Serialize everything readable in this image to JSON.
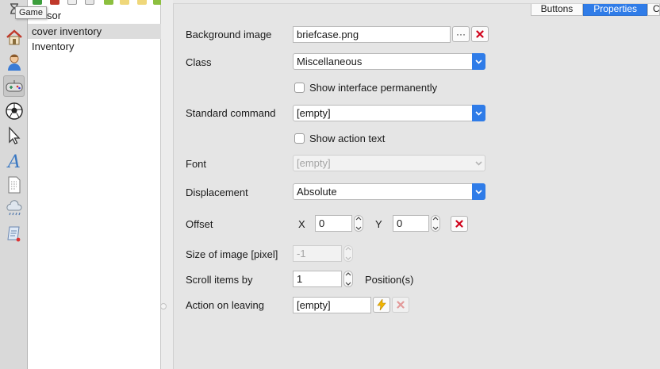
{
  "tooltip": "Game",
  "tree": {
    "items": [
      {
        "label": "sor"
      },
      {
        "label": "cover inventory"
      },
      {
        "label": "Inventory"
      }
    ]
  },
  "tabs": [
    {
      "label": "Buttons"
    },
    {
      "label": "Properties"
    },
    {
      "label": "C"
    }
  ],
  "form": {
    "background_image": {
      "label": "Background image",
      "value": "briefcase.png",
      "browse": "···"
    },
    "class": {
      "label": "Class",
      "value": "Miscellaneous"
    },
    "show_interface": {
      "label": "Show interface permanently",
      "checked": false
    },
    "standard_command": {
      "label": "Standard command",
      "value": "[empty]"
    },
    "show_action_text": {
      "label": "Show action text",
      "checked": false
    },
    "font": {
      "label": "Font",
      "value": "[empty]"
    },
    "displacement": {
      "label": "Displacement",
      "value": "Absolute"
    },
    "offset": {
      "label": "Offset",
      "x_label": "X",
      "x_value": "0",
      "y_label": "Y",
      "y_value": "0"
    },
    "size_of_image": {
      "label": "Size of image [pixel]",
      "value": "-1"
    },
    "scroll_items": {
      "label": "Scroll items by",
      "value": "1",
      "suffix": "Position(s)"
    },
    "action_on_leaving": {
      "label": "Action on leaving",
      "value": "[empty]"
    }
  },
  "colors": {
    "accent": "#2f7ce8",
    "delete": "#d0021b"
  },
  "icons": [
    "home-icon",
    "character-icon",
    "gamepad-icon",
    "ball-icon",
    "cursor-icon",
    "font-icon",
    "document-icon",
    "weather-icon",
    "script-icon"
  ]
}
